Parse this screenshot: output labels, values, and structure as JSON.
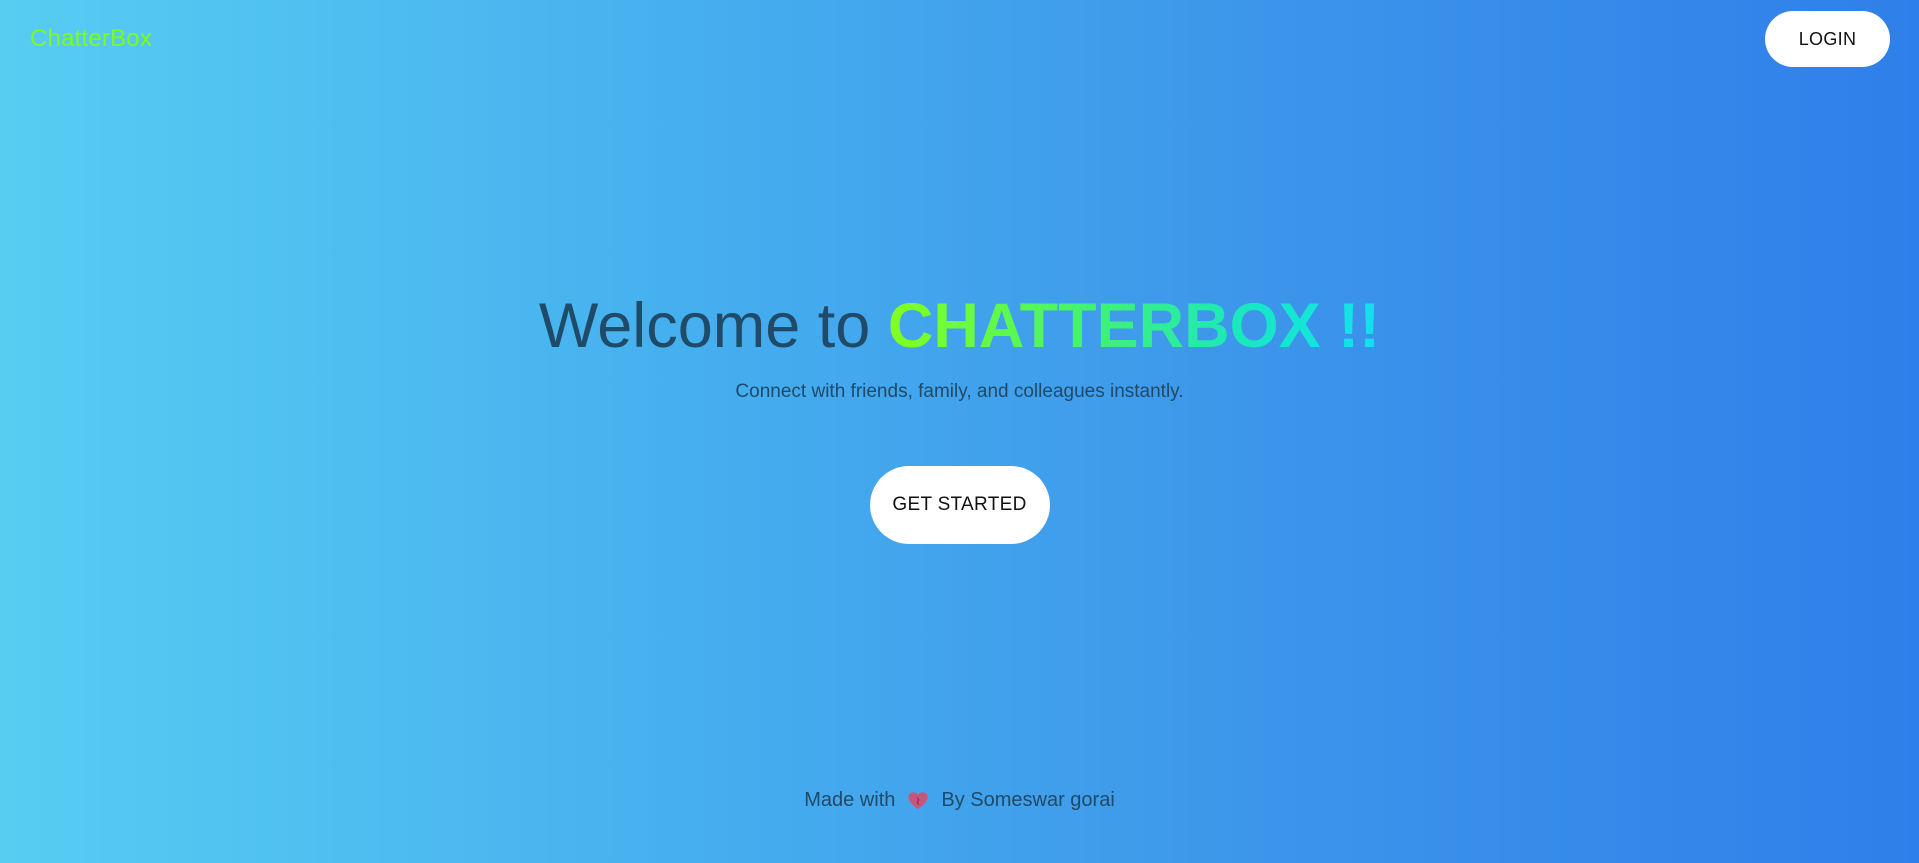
{
  "header": {
    "logo": "ChatterBox",
    "login_label": "LOGIN"
  },
  "hero": {
    "title_prefix": "Welcome to ",
    "brand": "CHATTERBOX !!",
    "subtitle": "Connect with friends, family, and colleagues instantly.",
    "cta_label": "GET STARTED"
  },
  "footer": {
    "made_with": "Made with",
    "icon": "heart-icon",
    "by": "By Someswar gorai"
  },
  "colors": {
    "logo": "#7cfc1c",
    "text": "#1f4a68",
    "button_bg": "#ffffff",
    "heart": "#c9567a"
  }
}
